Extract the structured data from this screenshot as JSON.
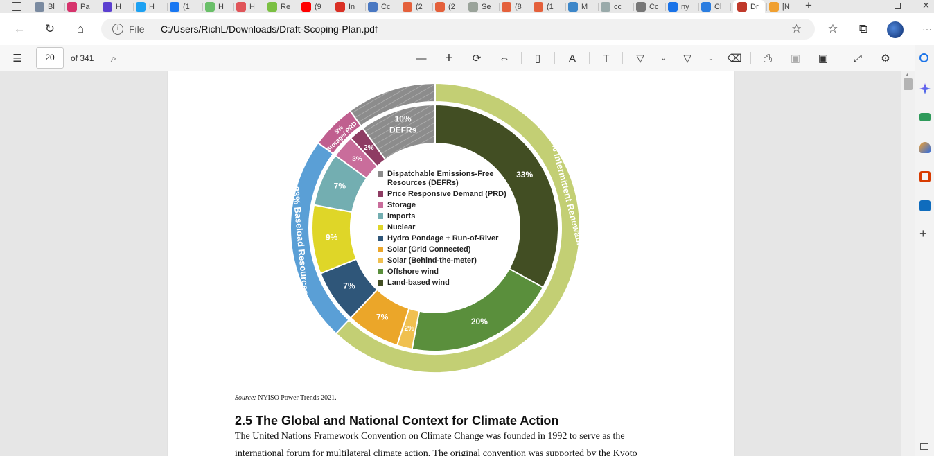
{
  "tabs": [
    {
      "label": "Bl",
      "icon": "blog-icon",
      "color": "#7a8aa0"
    },
    {
      "label": "Pa",
      "icon": "parler-icon",
      "color": "#d6336c"
    },
    {
      "label": "H",
      "icon": "t-logo-icon",
      "color": "#5b3fd0"
    },
    {
      "label": "H",
      "icon": "twitter-icon",
      "color": "#1da1f2"
    },
    {
      "label": "(1",
      "icon": "facebook-icon",
      "color": "#1877f2"
    },
    {
      "label": "H",
      "icon": "g-icon",
      "color": "#6abf69"
    },
    {
      "label": "H",
      "icon": "ribbon-icon",
      "color": "#e0555a"
    },
    {
      "label": "Re",
      "icon": "rumble-icon",
      "color": "#7bc043"
    },
    {
      "label": "(9",
      "icon": "youtube-icon",
      "color": "#ff0000"
    },
    {
      "label": "In",
      "icon": "gmail-icon",
      "color": "#d93025"
    },
    {
      "label": "Cc",
      "icon": "doc-icon",
      "color": "#4a78c2"
    },
    {
      "label": "(2",
      "icon": "tumblr-icon",
      "color": "#e4603b"
    },
    {
      "label": "(2",
      "icon": "tumblr-icon",
      "color": "#e4603b"
    },
    {
      "label": "Se",
      "icon": "seal-icon",
      "color": "#9aa39a"
    },
    {
      "label": "(8",
      "icon": "tumblr-icon",
      "color": "#e4603b"
    },
    {
      "label": "(1",
      "icon": "tumblr-icon",
      "color": "#e4603b"
    },
    {
      "label": "M",
      "icon": "outlook-icon",
      "color": "#3d87c9"
    },
    {
      "label": "cc",
      "icon": "search-icon",
      "color": "#9aa"
    },
    {
      "label": "Cc",
      "icon": "page-icon",
      "color": "#777"
    },
    {
      "label": "ny",
      "icon": "search-icon",
      "color": "#1a73e8"
    },
    {
      "label": "Cl",
      "icon": "azure-icon",
      "color": "#2b7de0"
    },
    {
      "label": "Dr",
      "icon": "pdf-icon",
      "color": "#c0392b",
      "active": true
    },
    {
      "label": "[N",
      "icon": "notes-icon",
      "color": "#f0a030"
    }
  ],
  "address": {
    "scheme": "File",
    "url": "C:/Users/RichL/Downloads/Draft-Scoping-Plan.pdf"
  },
  "pdf_toolbar": {
    "page": "20",
    "total": "of 341"
  },
  "chart_data": {
    "type": "pie",
    "outer": [
      {
        "label": "DEFRs",
        "pct": 10,
        "color": "#8c8c8c",
        "hatched": true
      },
      {
        "label": "Storage/ PRD",
        "pct": 5,
        "color": "#c05f8f"
      },
      {
        "label": "Baseload Resources",
        "pct": 23,
        "color": "#5a9fd6"
      },
      {
        "label": "Intermittent Renewables",
        "pct": 62,
        "color": "#c3cf74"
      }
    ],
    "inner": [
      {
        "label": "Land-based wind",
        "pct": 33,
        "color": "#424e23"
      },
      {
        "label": "Offshore wind",
        "pct": 20,
        "color": "#5a8f3c"
      },
      {
        "label": "Solar (Behind-the-meter)",
        "pct": 2,
        "color": "#f0c050"
      },
      {
        "label": "Solar (Grid Connected)",
        "pct": 7,
        "color": "#eba629"
      },
      {
        "label": "Hydro Pondage + Run-of-River",
        "pct": 7,
        "color": "#2f5679"
      },
      {
        "label": "Nuclear",
        "pct": 9,
        "color": "#dfd628"
      },
      {
        "label": "Imports",
        "pct": 7,
        "color": "#73aeb1"
      },
      {
        "label": "Storage",
        "pct": 3,
        "color": "#c96d9b"
      },
      {
        "label": "Price Responsive Demand (PRD)",
        "pct": 2,
        "color": "#8e3c63"
      },
      {
        "label": "Dispatchable Emissions-Free Resources (DEFRs)",
        "pct": 10,
        "color": "#8c8c8c",
        "hatched": true
      }
    ],
    "legend": [
      {
        "label": "Dispatchable Emissions-Free Resources (DEFRs)",
        "color": "#8c8c8c"
      },
      {
        "label": "Price Responsive Demand (PRD)",
        "color": "#8e3c63"
      },
      {
        "label": "Storage",
        "color": "#c96d9b"
      },
      {
        "label": "Imports",
        "color": "#73aeb1"
      },
      {
        "label": "Nuclear",
        "color": "#dfd628"
      },
      {
        "label": "Hydro Pondage + Run-of-River",
        "color": "#2f5679"
      },
      {
        "label": "Solar (Grid Connected)",
        "color": "#eba629"
      },
      {
        "label": "Solar (Behind-the-meter)",
        "color": "#f0c050"
      },
      {
        "label": "Offshore wind",
        "color": "#5a8f3c"
      },
      {
        "label": "Land-based wind",
        "color": "#424e23"
      }
    ]
  },
  "doc": {
    "source_label": "Source:",
    "source_text": "NYISO Power Trends 2021.",
    "heading": "2.5 The Global and National Context for Climate Action",
    "para_line1": "The United Nations Framework Convention on Climate Change was founded in 1992 to serve as the",
    "para_line2": "international forum for multilateral climate action. The original convention was supported by the Kyoto"
  }
}
